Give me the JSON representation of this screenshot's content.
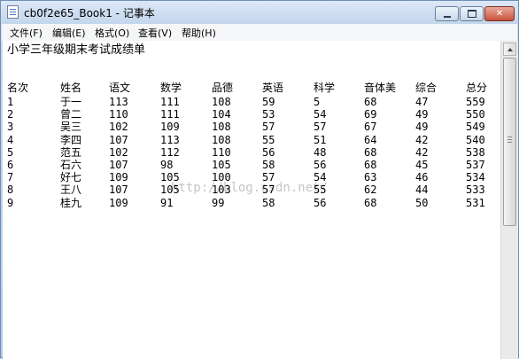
{
  "window": {
    "title": "cb0f2e65_Book1 - 记事本",
    "close_label": "✕"
  },
  "menu": [
    "文件(F)",
    "编辑(E)",
    "格式(O)",
    "查看(V)",
    "帮助(H)"
  ],
  "document": {
    "heading": "小学三年级期末考试成绩单",
    "headers": [
      "名次",
      "姓名",
      "语文",
      "数学",
      "品德",
      "英语",
      "科学",
      "音体美",
      "综合",
      "总分"
    ],
    "rows": [
      [
        "1",
        "于一",
        "113",
        "111",
        "108",
        "59",
        "5",
        "68",
        "47",
        "559"
      ],
      [
        "2",
        "曾二",
        "110",
        "111",
        "104",
        "53",
        "54",
        "69",
        "49",
        "550"
      ],
      [
        "3",
        "吴三",
        "102",
        "109",
        "108",
        "57",
        "57",
        "67",
        "49",
        "549"
      ],
      [
        "4",
        "李四",
        "107",
        "113",
        "108",
        "55",
        "51",
        "64",
        "42",
        "540"
      ],
      [
        "5",
        "范五",
        "102",
        "112",
        "110",
        "56",
        "48",
        "68",
        "42",
        "538"
      ],
      [
        "6",
        "石六",
        "107",
        "98",
        "105",
        "58",
        "56",
        "68",
        "45",
        "537"
      ],
      [
        "7",
        "好七",
        "109",
        "105",
        "100",
        "57",
        "54",
        "63",
        "46",
        "534"
      ],
      [
        "8",
        "王八",
        "107",
        "105",
        "103",
        "57",
        "55",
        "62",
        "44",
        "533"
      ],
      [
        "9",
        "桂九",
        "109",
        "91",
        "99",
        "58",
        "56",
        "68",
        "50",
        "531"
      ]
    ]
  },
  "watermark": "http://blog.csdn.net/"
}
